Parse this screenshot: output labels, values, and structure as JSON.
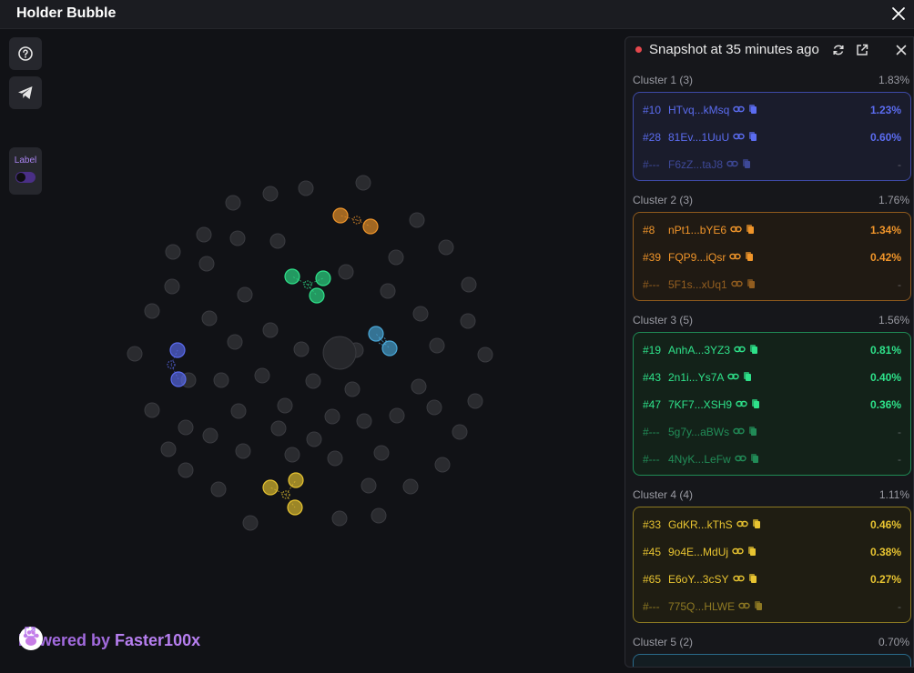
{
  "window": {
    "title": "Holder Bubble"
  },
  "toolbar": {
    "label_text": "Label"
  },
  "footer": {
    "powered_text": "Powered by",
    "brand": "Faster100x"
  },
  "panel": {
    "snapshot_text": "Snapshot at 35 minutes ago"
  },
  "clusters": [
    {
      "title": "Cluster 1 (3)",
      "total": "1.83%",
      "color": "#5b6cf0",
      "bg": "#1a1c2c",
      "border": "#3e4aa8",
      "rows": [
        {
          "rank": "#10",
          "addr": "HTvq...kMsq",
          "pct": "1.23%"
        },
        {
          "rank": "#28",
          "addr": "81Ev...1UuU",
          "pct": "0.60%"
        },
        {
          "rank": "#---",
          "addr": "F6zZ...taJ8",
          "pct": "-"
        }
      ]
    },
    {
      "title": "Cluster 2 (3)",
      "total": "1.76%",
      "color": "#f0952a",
      "bg": "#201a13",
      "border": "#8f5a1d",
      "rows": [
        {
          "rank": "#8",
          "addr": "nPt1...bYE6",
          "pct": "1.34%"
        },
        {
          "rank": "#39",
          "addr": "FQP9...iQsr",
          "pct": "0.42%"
        },
        {
          "rank": "#---",
          "addr": "5F1s...xUq1",
          "pct": "-"
        }
      ]
    },
    {
      "title": "Cluster 3 (5)",
      "total": "1.56%",
      "color": "#2ee28a",
      "bg": "#132219",
      "border": "#1f8a55",
      "rows": [
        {
          "rank": "#19",
          "addr": "AnhA...3YZ3",
          "pct": "0.81%"
        },
        {
          "rank": "#43",
          "addr": "2n1i...Ys7A",
          "pct": "0.40%"
        },
        {
          "rank": "#47",
          "addr": "7KF7...XSH9",
          "pct": "0.36%"
        },
        {
          "rank": "#---",
          "addr": "5g7y...aBWs",
          "pct": "-"
        },
        {
          "rank": "#---",
          "addr": "4NyK...LeFw",
          "pct": "-"
        }
      ]
    },
    {
      "title": "Cluster 4 (4)",
      "total": "1.11%",
      "color": "#e8c431",
      "bg": "#1f1d12",
      "border": "#8c7a22",
      "rows": [
        {
          "rank": "#33",
          "addr": "GdKR...kThS",
          "pct": "0.46%"
        },
        {
          "rank": "#45",
          "addr": "9o4E...MdUj",
          "pct": "0.38%"
        },
        {
          "rank": "#65",
          "addr": "E6oY...3cSY",
          "pct": "0.27%"
        },
        {
          "rank": "#---",
          "addr": "775Q...HLWE",
          "pct": "-"
        }
      ]
    },
    {
      "title": "Cluster 5 (2)",
      "total": "0.70%",
      "color": "#4aa8d8",
      "bg": "#131d22",
      "border": "#2a6a8a",
      "rows": []
    }
  ]
}
